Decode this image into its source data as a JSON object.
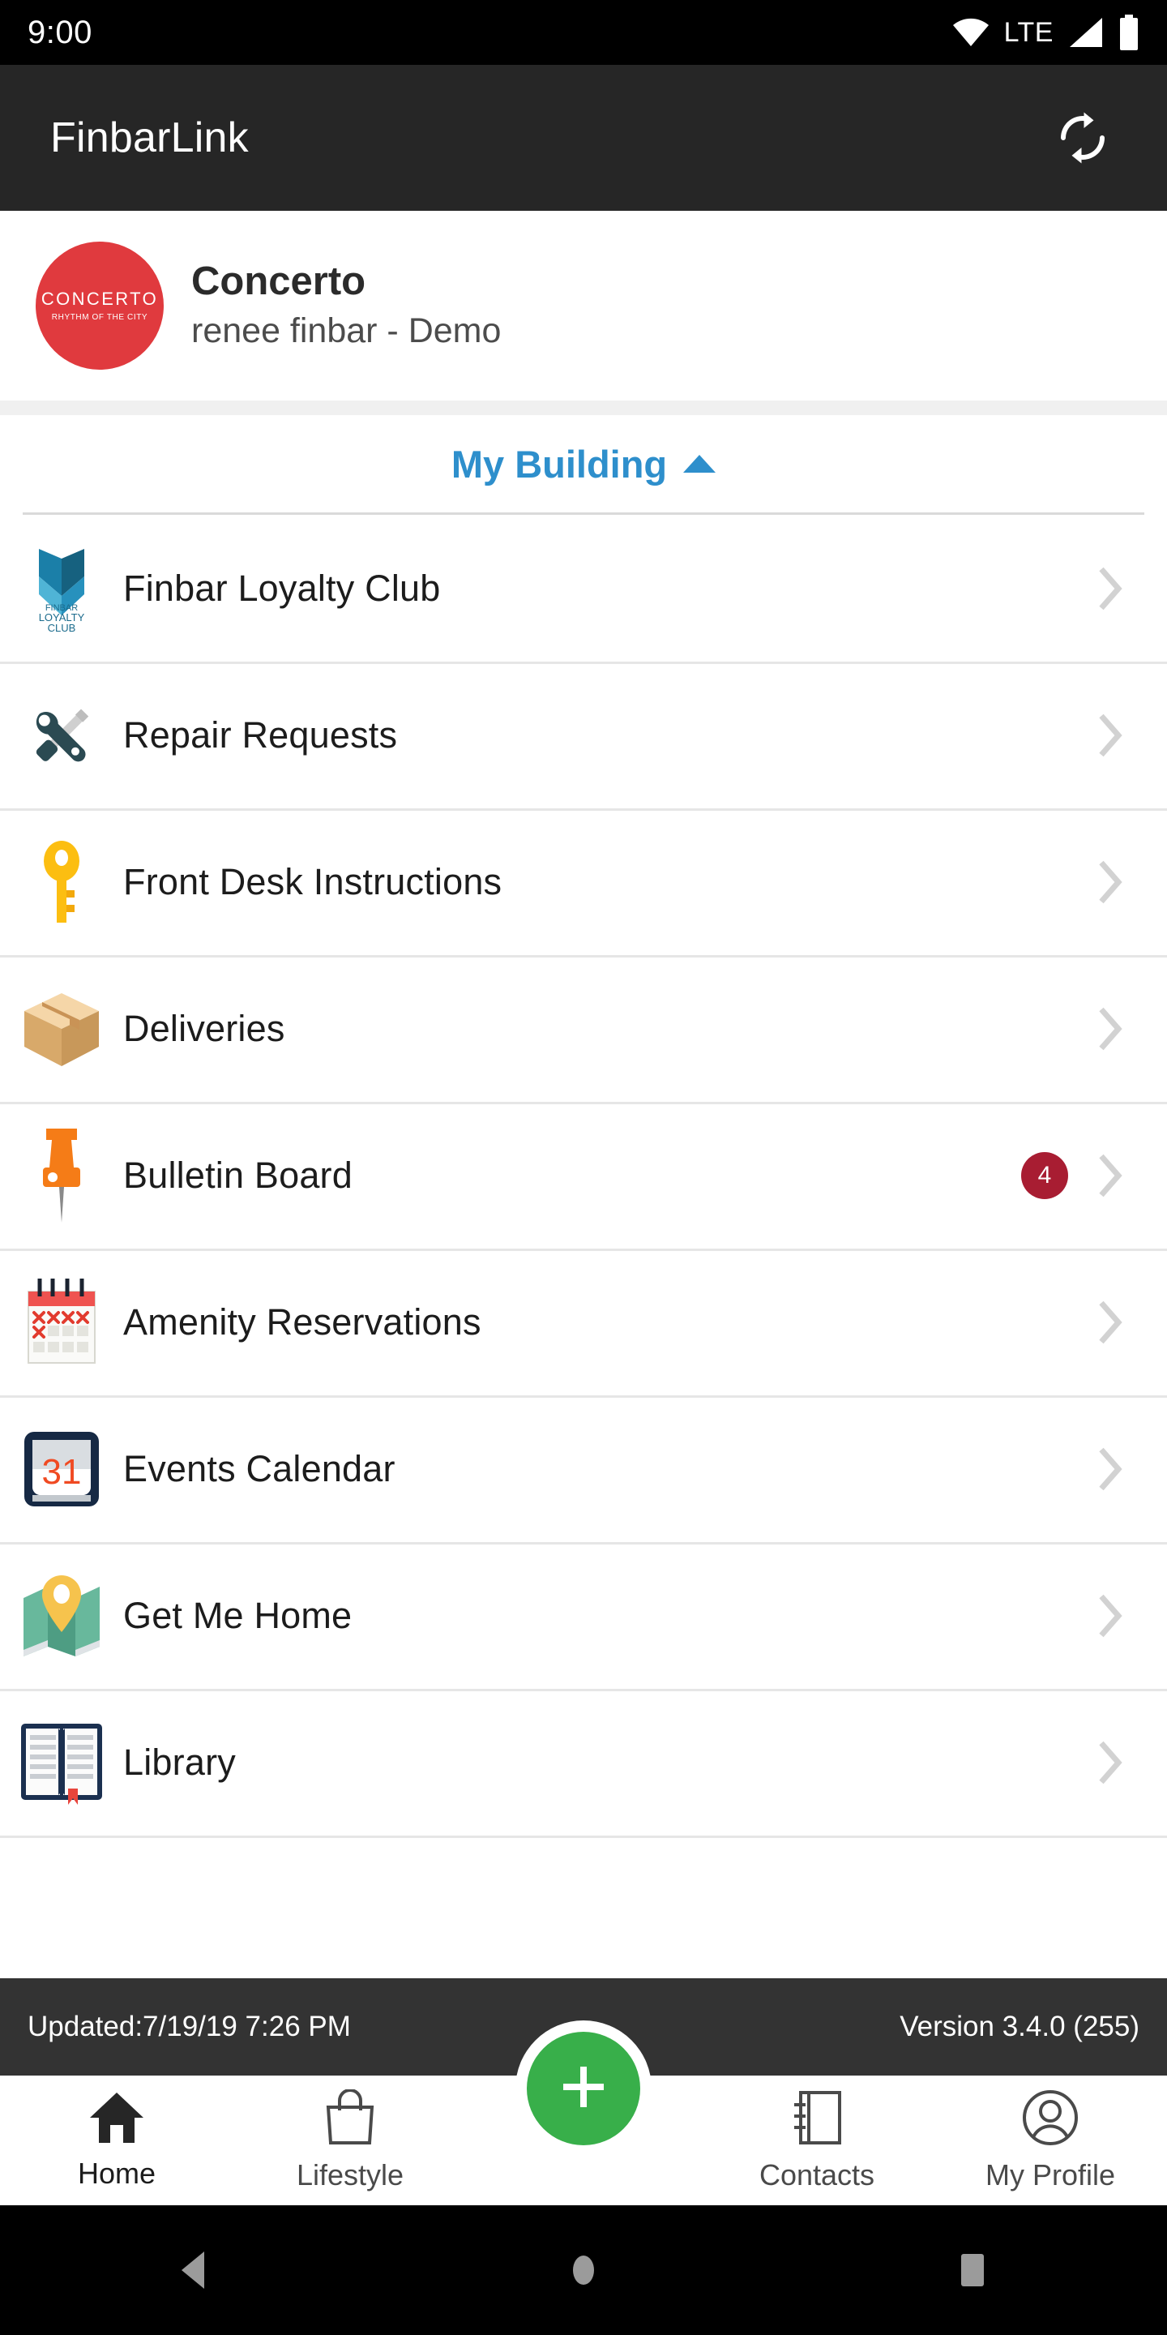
{
  "status_bar": {
    "time": "9:00",
    "network_label": "LTE",
    "icons": [
      "wifi-icon",
      "signal-icon",
      "battery-icon"
    ]
  },
  "app_bar": {
    "title": "FinbarLink",
    "refresh_icon": "refresh-icon"
  },
  "profile": {
    "logo_main": "CONCERTO",
    "logo_sub": "RHYTHM OF THE CITY",
    "name": "Concerto",
    "subtitle": "renee finbar - Demo",
    "logo_color": "#e03a3e"
  },
  "section": {
    "title": "My Building",
    "expanded": true,
    "caret_icon": "caret-up-icon",
    "accent_color": "#2e8fcc"
  },
  "menu_items": [
    {
      "label": "Finbar Loyalty Club",
      "icon": "finbar-loyalty-club-icon",
      "badge": null
    },
    {
      "label": "Repair Requests",
      "icon": "tools-icon",
      "badge": null
    },
    {
      "label": "Front Desk Instructions",
      "icon": "key-icon",
      "badge": null
    },
    {
      "label": "Deliveries",
      "icon": "package-icon",
      "badge": null
    },
    {
      "label": "Bulletin Board",
      "icon": "pushpin-icon",
      "badge": "4"
    },
    {
      "label": "Amenity Reservations",
      "icon": "spiral-calendar-icon",
      "badge": null
    },
    {
      "label": "Events Calendar",
      "icon": "calendar-31-icon",
      "badge": null
    },
    {
      "label": "Get Me Home",
      "icon": "map-pin-icon",
      "badge": null
    },
    {
      "label": "Library",
      "icon": "open-book-icon",
      "badge": null
    }
  ],
  "footer_meta": {
    "updated": "Updated:7/19/19 7:26 PM",
    "version": "Version 3.4.0 (255)"
  },
  "bottom_nav": {
    "items": [
      {
        "label": "Home",
        "icon": "home-icon",
        "active": true
      },
      {
        "label": "Lifestyle",
        "icon": "shopping-bag-icon",
        "active": false
      },
      {
        "label": "Contacts",
        "icon": "address-book-icon",
        "active": false
      },
      {
        "label": "My Profile",
        "icon": "person-circle-icon",
        "active": false
      }
    ],
    "fab": {
      "icon": "plus-icon",
      "color": "#38af4a"
    }
  },
  "android_nav": {
    "back": "back-triangle-icon",
    "home": "home-circle-icon",
    "recents": "recents-square-icon"
  }
}
